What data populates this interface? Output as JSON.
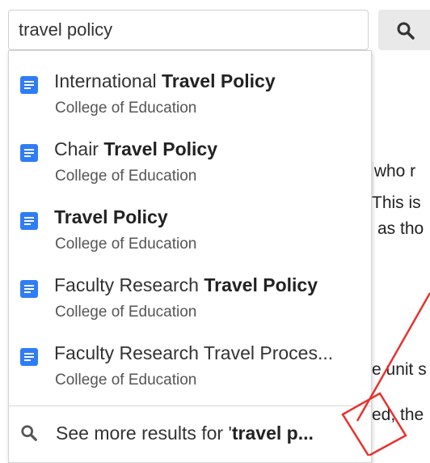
{
  "search": {
    "value": "travel policy",
    "button_icon": "search-icon"
  },
  "background_text": {
    "lines": [
      "r who r",
      "This is",
      "as tho",
      "e unit s",
      "ed, the"
    ]
  },
  "results": [
    {
      "title_plain": "International ",
      "title_bold": "Travel Policy",
      "subtitle": "College of Education",
      "icon": "document-icon"
    },
    {
      "title_plain": "Chair ",
      "title_bold": "Travel Policy",
      "subtitle": "College of Education",
      "icon": "document-icon"
    },
    {
      "title_plain": "",
      "title_bold": "Travel Policy",
      "subtitle": "College of Education",
      "icon": "document-icon"
    },
    {
      "title_plain": "Faculty Research ",
      "title_bold": "Travel Policy",
      "subtitle": "College of Education",
      "icon": "document-icon"
    },
    {
      "title_plain": "Faculty Research Travel Proces...",
      "title_bold": "",
      "subtitle": "College of Education",
      "icon": "document-icon"
    }
  ],
  "see_more": {
    "prefix": "See more results for '",
    "query_bold": "travel p...",
    "icon": "search-icon"
  },
  "colors": {
    "doc_icon": "#2f7df6",
    "annotation": "#e8322f",
    "search_button_bg": "#e9e9e9"
  }
}
